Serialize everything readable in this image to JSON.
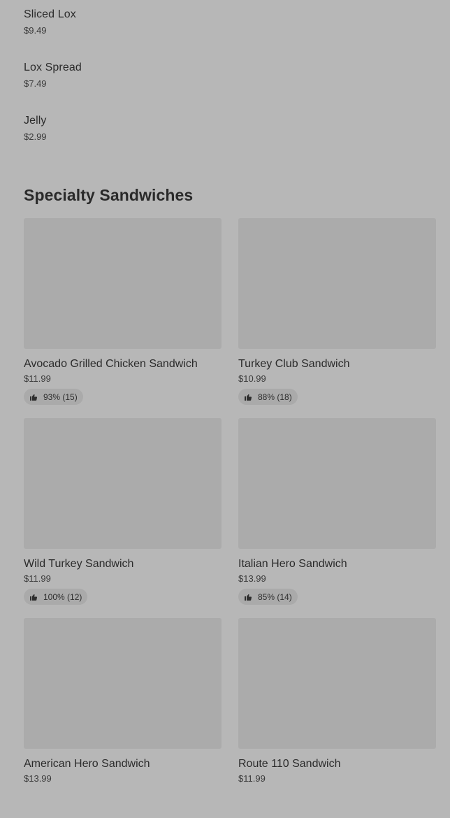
{
  "simple_items": [
    {
      "name": "Sliced Lox",
      "price": "$9.49"
    },
    {
      "name": "Lox Spread",
      "price": "$7.49"
    },
    {
      "name": "Jelly",
      "price": "$2.99"
    }
  ],
  "section": {
    "title": "Specialty Sandwiches",
    "items": [
      {
        "name": "Avocado Grilled Chicken Sandwich",
        "price": "$11.99",
        "rating": "93% (15)"
      },
      {
        "name": "Turkey Club Sandwich",
        "price": "$10.99",
        "rating": "88% (18)"
      },
      {
        "name": "Wild Turkey Sandwich",
        "price": "$11.99",
        "rating": "100% (12)"
      },
      {
        "name": "Italian Hero Sandwich",
        "price": "$13.99",
        "rating": "85% (14)"
      },
      {
        "name": "American Hero Sandwich",
        "price": "$13.99",
        "rating": ""
      },
      {
        "name": "Route 110 Sandwich",
        "price": "$11.99",
        "rating": ""
      }
    ]
  },
  "icons": {
    "rating": "thumbs-up-icon"
  },
  "colors": {
    "overlay_background": "#b7b7b7",
    "image_placeholder": "#ababab",
    "rating_pill": "#aaaaaa"
  }
}
